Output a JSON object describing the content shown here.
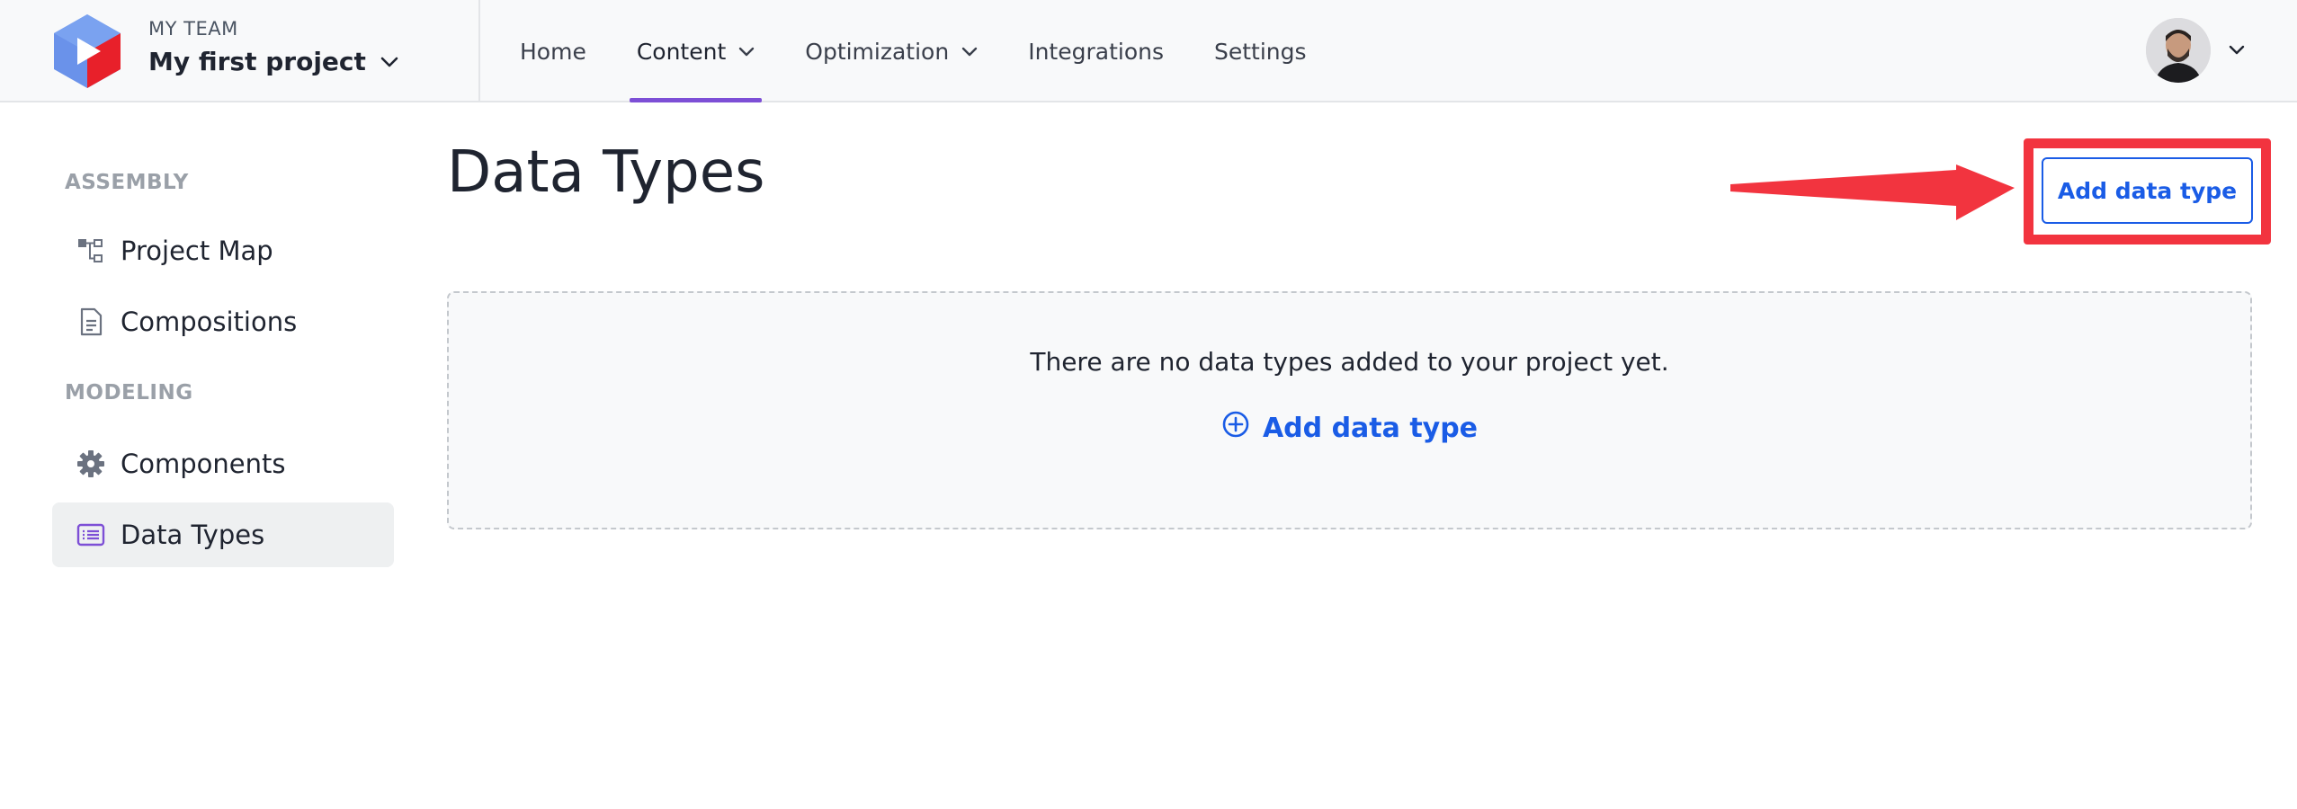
{
  "topbar": {
    "team_label": "MY TEAM",
    "project_name": "My first project",
    "nav": [
      {
        "label": "Home",
        "has_dropdown": false,
        "active": false
      },
      {
        "label": "Content",
        "has_dropdown": true,
        "active": true
      },
      {
        "label": "Optimization",
        "has_dropdown": true,
        "active": false
      },
      {
        "label": "Integrations",
        "has_dropdown": false,
        "active": false
      },
      {
        "label": "Settings",
        "has_dropdown": false,
        "active": false
      }
    ]
  },
  "sidebar": {
    "sections": [
      {
        "label": "ASSEMBLY",
        "items": [
          {
            "label": "Project Map",
            "icon": "sitemap-icon"
          },
          {
            "label": "Compositions",
            "icon": "document-icon"
          }
        ]
      },
      {
        "label": "MODELING",
        "items": [
          {
            "label": "Components",
            "icon": "gear-icon"
          },
          {
            "label": "Data Types",
            "icon": "list-icon",
            "active": true
          }
        ]
      }
    ]
  },
  "main": {
    "title": "Data Types",
    "add_button_label": "Add data type",
    "empty_message": "There are no data types added to your project yet.",
    "empty_add_label": "Add data type"
  },
  "colors": {
    "accent_blue": "#1a5ce6",
    "nav_underline": "#7d4fd6",
    "annotation_red": "#f2343f",
    "sidebar_active": "#eef0f1"
  }
}
